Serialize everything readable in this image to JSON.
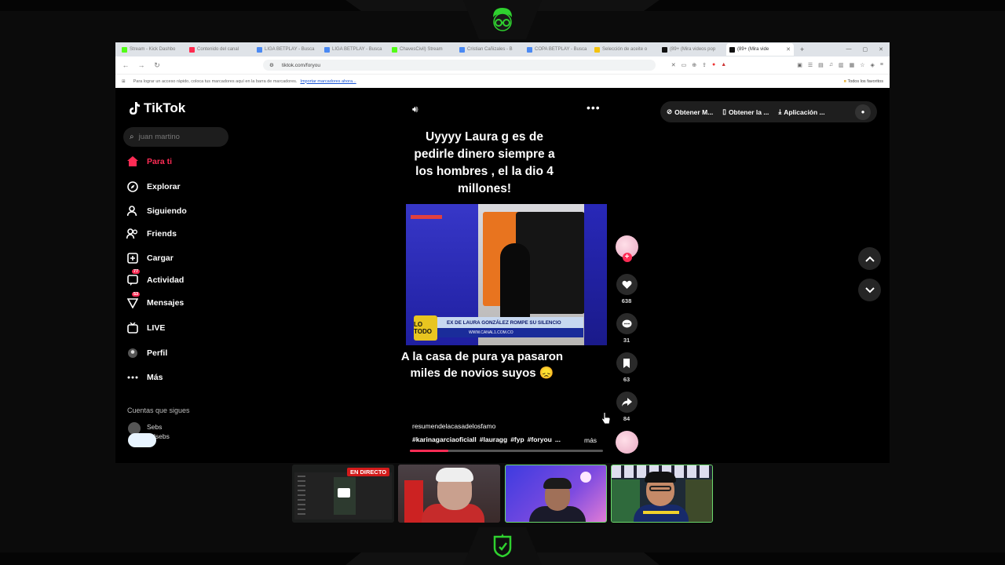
{
  "browser": {
    "tabs": [
      {
        "label": "Stream - Kick Dashbo",
        "color": "#53fc18"
      },
      {
        "label": "Contenido del canal",
        "color": "#ff2a4f"
      },
      {
        "label": "LIGA BETPLAY - Busca",
        "color": "#4a89f3"
      },
      {
        "label": "LIGA BETPLAY - Busca",
        "color": "#4a89f3"
      },
      {
        "label": "ChavesCivil) Stream",
        "color": "#53fc18"
      },
      {
        "label": "Cristian Cañizales - B",
        "color": "#4a89f3"
      },
      {
        "label": "COPA BETPLAY - Busca",
        "color": "#4a89f3"
      },
      {
        "label": "Selección de aceite o",
        "color": "#f4c20d"
      },
      {
        "label": "(89+ (Mira videos pop",
        "color": "#111111"
      },
      {
        "label": "(89+ (Mira vide",
        "color": "#111111"
      }
    ],
    "url": "tiktok.com/foryou",
    "bookmark_hint": "Para lograr un acceso rápido, coloca tus marcadores aquí en la barra de marcadores.",
    "bookmark_link": "Importar marcadores ahora...",
    "favorites": "Todos los favoritos"
  },
  "tiktok": {
    "logo": "TikTok",
    "search_placeholder": "juan martino",
    "menu": [
      {
        "label": "Para ti",
        "icon": "home-icon",
        "active": true
      },
      {
        "label": "Explorar",
        "icon": "compass-icon"
      },
      {
        "label": "Siguiendo",
        "icon": "user-follow-icon"
      },
      {
        "label": "Friends",
        "icon": "friends-icon"
      },
      {
        "label": "Cargar",
        "icon": "upload-icon"
      },
      {
        "label": "Actividad",
        "icon": "activity-icon",
        "badge": "77"
      },
      {
        "label": "Mensajes",
        "icon": "message-icon",
        "badge": "53"
      },
      {
        "label": "LIVE",
        "icon": "live-icon"
      },
      {
        "label": "Perfil",
        "icon": "profile-icon"
      },
      {
        "label": "Más",
        "icon": "more-icon"
      }
    ],
    "following_header": "Cuentas que sigues",
    "following_user": "Sebs\nsalsebs",
    "top_buttons": [
      "Obtener M...",
      "Obtener la ...",
      "Aplicación ..."
    ],
    "video": {
      "caption_top": "Uyyyy Laura g es de pedirle dinero siempre a los hombres , el la dio 4 millones!",
      "lower_third": "EX DE LAURA GONZÁLEZ ROMPE SU SILENCIO",
      "lower_third_sub": "WWW.CANAL1.COM.CO",
      "channel_logo": "LO TODO",
      "caption_bottom": "A la casa de pura ya pasaron miles de novios suyos 😞",
      "author": "resumendelacasadelosfamo",
      "hashtags": [
        "#karinagarciaoficiall",
        "#lauragg",
        "#fyp",
        "#foryou",
        "..."
      ],
      "more": "más",
      "progress": 0.2
    },
    "rail": {
      "likes": "638",
      "comments": "31",
      "saves": "63",
      "shares": "84"
    }
  },
  "overlay": {
    "live_tag": "EN DIRECTO"
  },
  "colors": {
    "accent": "#fe2c55",
    "brand_green": "#53fc18"
  }
}
